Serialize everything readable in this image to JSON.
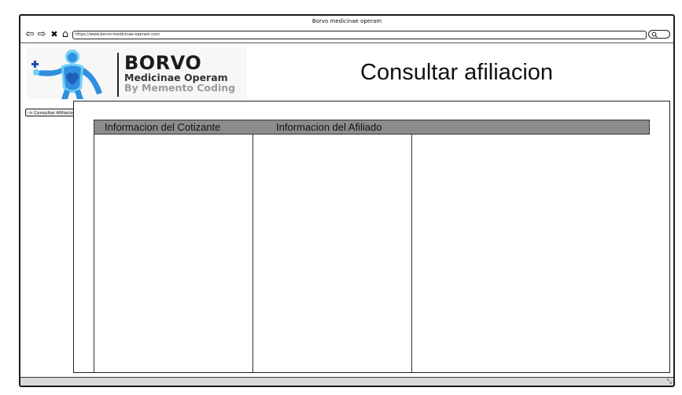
{
  "window": {
    "title": "Borvo medicinae operam",
    "url": "https://www.borvo-medicinae-operam.com"
  },
  "toolbar": {
    "back_icon": "⇦",
    "forward_icon": "⇨",
    "close_icon": "✖",
    "home_icon": "⌂"
  },
  "logo": {
    "title": "BORVO",
    "subtitle": "Medicinae Operam",
    "byline": "By Memento Coding",
    "colors": {
      "primary": "#2f8fe0",
      "light": "#6fd0f5",
      "heart": "#1f5fb8",
      "cross": "#1a4db0"
    }
  },
  "page": {
    "title": "Consultar afiliacion"
  },
  "sidebar": {
    "items": [
      {
        "label": "-> Consultar Afiliacion"
      }
    ]
  },
  "table": {
    "columns": [
      {
        "label": "Informacion del Cotizante"
      },
      {
        "label": "Informacion del Afiliado"
      },
      {
        "label": ""
      }
    ],
    "header_color": "#8c8c8c"
  },
  "statusbar": {
    "resize_icon": "⤡"
  }
}
